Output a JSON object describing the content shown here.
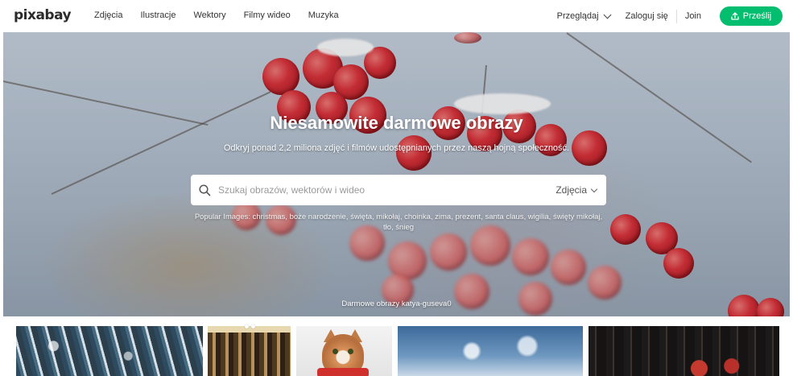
{
  "header": {
    "logo": "pixabay",
    "nav": [
      "Zdjęcia",
      "Ilustracje",
      "Wektory",
      "Filmy wideo",
      "Muzyka"
    ],
    "browse_label": "Przeglądaj",
    "login_label": "Zaloguj się",
    "join_label": "Join",
    "upload_label": "Prześlij",
    "accent_color": "#02be6e"
  },
  "hero": {
    "title": "Niesamowite darmowe obrazy",
    "subtitle": "Odkryj ponad 2,2 miliona zdjęć i filmów udostępnianych przez naszą hojną społeczność.",
    "search": {
      "placeholder": "Szukaj obrazów, wektorów i wideo",
      "value": "",
      "type_label": "Zdjęcia"
    },
    "popular_prefix": "Popular Images:",
    "popular_tags": "christmas, boże narodzenie, święta, mikołaj, choinka, zima, prezent, santa claus, wigilia, święty mikołaj, tło, śnieg",
    "credit": "Darmowe obrazy katya-guseva0"
  },
  "icons": {
    "search": "search-icon",
    "upload": "upload-icon",
    "browse_chevron": "chevron-down-icon"
  }
}
